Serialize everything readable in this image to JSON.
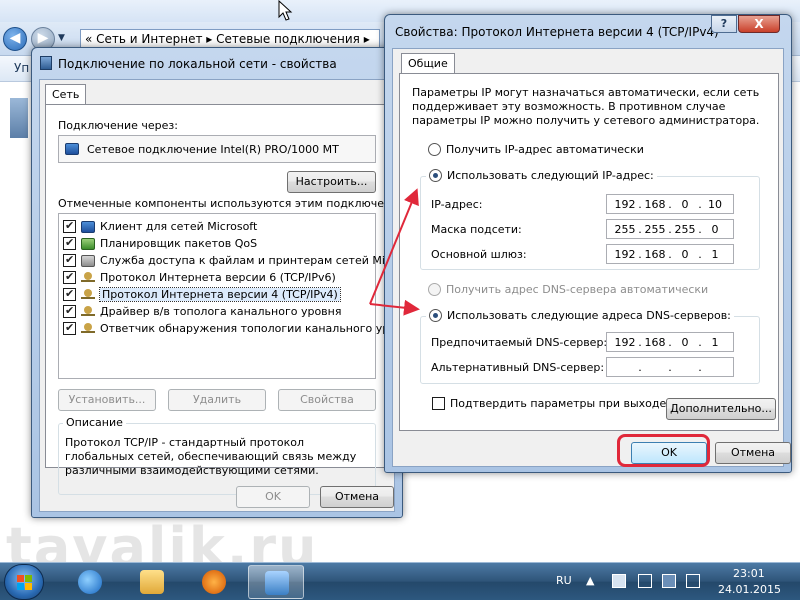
{
  "explorer": {
    "breadcrumb_prefix": "«",
    "breadcrumb_1": "Сеть и Интернет",
    "breadcrumb_2": "Сетевые подключения",
    "toolbar_fragment": "Уп"
  },
  "lan_dialog": {
    "title": "Подключение по локальной сети - свойства",
    "tab": "Сеть",
    "connect_using_label": "Подключение через:",
    "adapter_name": "Сетевое подключение Intel(R) PRO/1000 MT",
    "configure_button": "Настроить...",
    "components_label": "Отмеченные компоненты используются этим подключением:",
    "components": [
      {
        "label": "Клиент для сетей Microsoft",
        "checked": true,
        "icon": "network-client-icon"
      },
      {
        "label": "Планировщик пакетов QoS",
        "checked": true,
        "icon": "qos-icon"
      },
      {
        "label": "Служба доступа к файлам и принтерам сетей Micro...",
        "checked": true,
        "icon": "file-sharing-icon"
      },
      {
        "label": "Протокол Интернета версии 6 (TCP/IPv6)",
        "checked": true,
        "icon": "protocol-icon"
      },
      {
        "label": "Протокол Интернета версии 4 (TCP/IPv4)",
        "checked": true,
        "icon": "protocol-icon",
        "selected": true
      },
      {
        "label": "Драйвер в/в тополога канального уровня",
        "checked": true,
        "icon": "protocol-icon"
      },
      {
        "label": "Ответчик обнаружения топологии канального уровня",
        "checked": true,
        "icon": "protocol-icon"
      }
    ],
    "install_button": "Установить...",
    "uninstall_button": "Удалить",
    "properties_button": "Свойства",
    "description_title": "Описание",
    "description_text": "Протокол TCP/IP - стандартный протокол глобальных сетей, обеспечивающий связь между различными взаимодействующими сетями.",
    "ok_button": "OK",
    "cancel_button": "Отмена"
  },
  "ipv4_dialog": {
    "title": "Свойства: Протокол Интернета версии 4 (TCP/IPv4)",
    "help_glyph": "?",
    "close_glyph": "X",
    "tab": "Общие",
    "intro_text": "Параметры IP могут назначаться автоматически, если сеть поддерживает эту возможность. В противном случае параметры IP можно получить у сетевого администратора.",
    "radio_auto_ip": "Получить IP-адрес автоматически",
    "radio_manual_ip": "Использовать следующий IP-адрес:",
    "ip_label": "IP-адрес:",
    "ip_value": [
      "192",
      "168",
      "0",
      "10"
    ],
    "mask_label": "Маска подсети:",
    "mask_value": [
      "255",
      "255",
      "255",
      "0"
    ],
    "gateway_label": "Основной шлюз:",
    "gateway_value": [
      "192",
      "168",
      "0",
      "1"
    ],
    "radio_auto_dns": "Получить адрес DNS-сервера автоматически",
    "radio_manual_dns": "Использовать следующие адреса DNS-серверов:",
    "preferred_dns_label": "Предпочитаемый DNS-сервер:",
    "preferred_dns_value": [
      "192",
      "168",
      "0",
      "1"
    ],
    "alternate_dns_label": "Альтернативный DNS-сервер:",
    "alternate_dns_value": [
      "",
      "",
      "",
      ""
    ],
    "validate_label": "Подтвердить параметры при выходе",
    "validate_checked": false,
    "advanced_button": "Дополнительно...",
    "ok_button": "OK",
    "cancel_button": "Отмена"
  },
  "taskbar": {
    "language": "RU",
    "time": "23:01",
    "date": "24.01.2015"
  },
  "watermark": "tavalik.ru",
  "colors": {
    "highlight": "#e0283a",
    "arrow": "#e0283a"
  }
}
